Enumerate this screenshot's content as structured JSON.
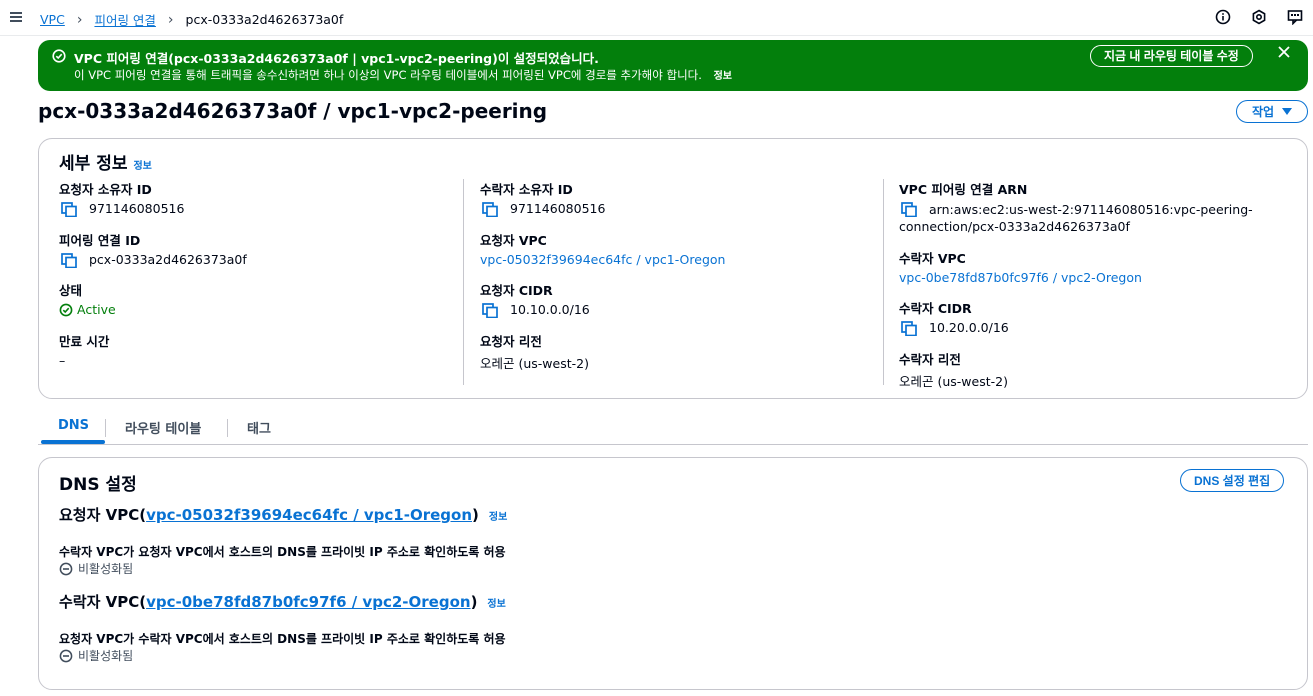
{
  "breadcrumb": {
    "items": [
      "VPC",
      "피어링 연결"
    ],
    "current": "pcx-0333a2d4626373a0f"
  },
  "flash": {
    "title": "VPC 피어링 연결(pcx-0333a2d4626373a0f | vpc1-vpc2-peering)이 설정되었습니다.",
    "body": "이 VPC 피어링 연결을 통해 트래픽을 송수신하려면 하나 이상의 VPC 라우팅 테이블에서 피어링된 VPC에 경로를 추가해야 합니다.",
    "info": "정보",
    "button": "지금 내 라우팅 테이블 수정"
  },
  "page": {
    "title": "pcx-0333a2d4626373a0f / vpc1-vpc2-peering",
    "actions": "작업"
  },
  "details": {
    "title": "세부 정보",
    "info": "정보",
    "col1": {
      "requester_owner_label": "요청자 소유자 ID",
      "requester_owner_value": "971146080516",
      "peering_id_label": "피어링 연결 ID",
      "peering_id_value": "pcx-0333a2d4626373a0f",
      "status_label": "상태",
      "status_value": "Active",
      "expiry_label": "만료 시간",
      "expiry_value": "–"
    },
    "col2": {
      "accepter_owner_label": "수락자 소유자 ID",
      "accepter_owner_value": "971146080516",
      "requester_vpc_label": "요청자 VPC",
      "requester_vpc_value": "vpc-05032f39694ec64fc / vpc1-Oregon",
      "requester_cidr_label": "요청자 CIDR",
      "requester_cidr_value": "10.10.0.0/16",
      "requester_region_label": "요청자 리전",
      "requester_region_value": "오레곤 (us-west-2)"
    },
    "col3": {
      "arn_label": "VPC 피어링 연결 ARN",
      "arn_value_line1": "arn:aws:ec2:us-west-2:971146080516:vpc-peering-",
      "arn_value_line2": "connection/pcx-0333a2d4626373a0f",
      "accepter_vpc_label": "수락자 VPC",
      "accepter_vpc_value": "vpc-0be78fd87b0fc97f6 / vpc2-Oregon",
      "accepter_cidr_label": "수락자 CIDR",
      "accepter_cidr_value": "10.20.0.0/16",
      "accepter_region_label": "수락자 리전",
      "accepter_region_value": "오레곤 (us-west-2)"
    }
  },
  "tabs": [
    "DNS",
    "라우팅 테이블",
    "태그"
  ],
  "dns": {
    "title": "DNS 설정",
    "edit_button": "DNS 설정 편집",
    "requester": {
      "prefix": "요청자 VPC(",
      "link": "vpc-05032f39694ec64fc / vpc1-Oregon",
      "suffix": ")",
      "info": "정보",
      "label": "수락자 VPC가 요청자 VPC에서 호스트의 DNS를 프라이빗 IP 주소로 확인하도록 허용",
      "value": "비활성화됨"
    },
    "accepter": {
      "prefix": "수락자 VPC(",
      "link": "vpc-0be78fd87b0fc97f6 / vpc2-Oregon",
      "suffix": ")",
      "info": "정보",
      "label": "요청자 VPC가 수락자 VPC에서 호스트의 DNS를 프라이빗 IP 주소로 확인하도록 허용",
      "value": "비활성화됨"
    }
  },
  "colors": {
    "success": "#037f0c",
    "link": "#0972d3",
    "border": "#c6c6cd"
  }
}
